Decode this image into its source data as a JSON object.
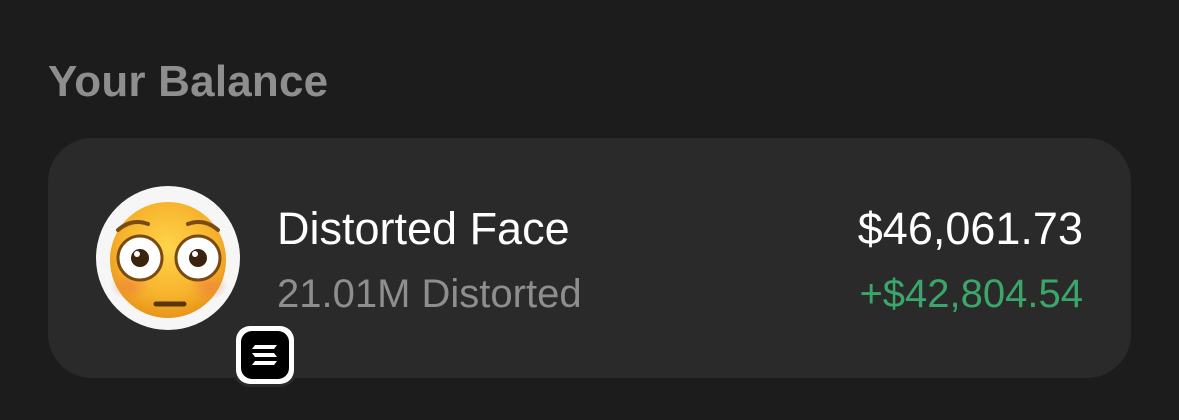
{
  "section": {
    "title": "Your Balance"
  },
  "token": {
    "name": "Distorted Face",
    "amount": "21.01M Distorted",
    "balance": "$46,061.73",
    "change": "+$42,804.54",
    "avatar_icon": "flushed-face-emoji-icon",
    "chain_icon": "solana-chain-icon"
  },
  "colors": {
    "background": "#1c1c1c",
    "card": "#2a2a2a",
    "muted_text": "#8e8e8e",
    "primary_text": "#ffffff",
    "positive": "#3aa66a"
  }
}
